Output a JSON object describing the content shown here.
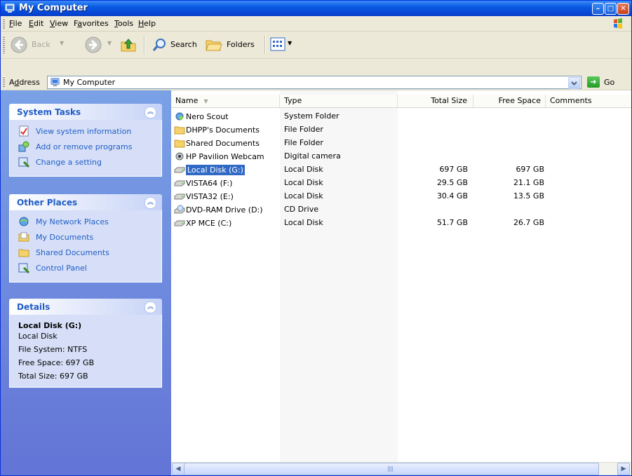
{
  "window": {
    "title": "My Computer"
  },
  "menu": [
    {
      "label": "File",
      "u": "F",
      "rest": "ile"
    },
    {
      "label": "Edit",
      "u": "E",
      "rest": "dit"
    },
    {
      "label": "View",
      "u": "V",
      "rest": "iew"
    },
    {
      "label": "Favorites",
      "u": "a",
      "pre": "F",
      "rest": "vorites"
    },
    {
      "label": "Tools",
      "u": "T",
      "rest": "ools"
    },
    {
      "label": "Help",
      "u": "H",
      "rest": "elp"
    }
  ],
  "toolbar": {
    "back_label": "Back",
    "search_label": "Search",
    "folders_label": "Folders"
  },
  "address": {
    "label_prefix": "A",
    "label_u": "d",
    "label_rest": "dress",
    "value": "My Computer",
    "go_label": "Go"
  },
  "tasks": {
    "system": {
      "title": "System Tasks",
      "items": [
        {
          "label": "View system information",
          "icon": "info-icon"
        },
        {
          "label": "Add or remove programs",
          "icon": "programs-icon"
        },
        {
          "label": "Change a setting",
          "icon": "control-panel-icon"
        }
      ]
    },
    "other": {
      "title": "Other Places",
      "items": [
        {
          "label": "My Network Places",
          "icon": "network-icon"
        },
        {
          "label": "My Documents",
          "icon": "documents-icon"
        },
        {
          "label": "Shared Documents",
          "icon": "folder-icon"
        },
        {
          "label": "Control Panel",
          "icon": "control-panel-icon"
        }
      ]
    },
    "details": {
      "title": "Details",
      "name": "Local Disk (G:)",
      "type": "Local Disk",
      "file_system": "File System: NTFS",
      "free_space": "Free Space: 697 GB",
      "total_size": "Total Size: 697 GB"
    }
  },
  "columns": [
    "Name",
    "Type",
    "Total Size",
    "Free Space",
    "Comments"
  ],
  "rows": [
    {
      "name": "Nero Scout",
      "type": "System Folder",
      "total": "",
      "free": "",
      "icon": "nero-scout-icon"
    },
    {
      "name": "DHPP's Documents",
      "type": "File Folder",
      "total": "",
      "free": "",
      "icon": "folder-icon"
    },
    {
      "name": "Shared Documents",
      "type": "File Folder",
      "total": "",
      "free": "",
      "icon": "folder-icon"
    },
    {
      "name": "HP Pavilion Webcam",
      "type": "Digital camera",
      "total": "",
      "free": "",
      "icon": "webcam-icon"
    },
    {
      "name": "Local Disk (G:)",
      "type": "Local Disk",
      "total": "697 GB",
      "free": "697 GB",
      "icon": "disk-icon",
      "selected": true
    },
    {
      "name": "VISTA64 (F:)",
      "type": "Local Disk",
      "total": "29.5 GB",
      "free": "21.1 GB",
      "icon": "disk-icon"
    },
    {
      "name": "VISTA32 (E:)",
      "type": "Local Disk",
      "total": "30.4 GB",
      "free": "13.5 GB",
      "icon": "disk-icon"
    },
    {
      "name": "DVD-RAM Drive (D:)",
      "type": "CD Drive",
      "total": "",
      "free": "",
      "icon": "dvd-drive-icon"
    },
    {
      "name": "XP MCE (C:)",
      "type": "Local Disk",
      "total": "51.7 GB",
      "free": "26.7 GB",
      "icon": "disk-icon"
    }
  ],
  "colors": {
    "title_blue": "#0a5ae0",
    "task_blue": "#215dc6",
    "selection": "#316ac5",
    "pane_blue": "#6375d6"
  }
}
